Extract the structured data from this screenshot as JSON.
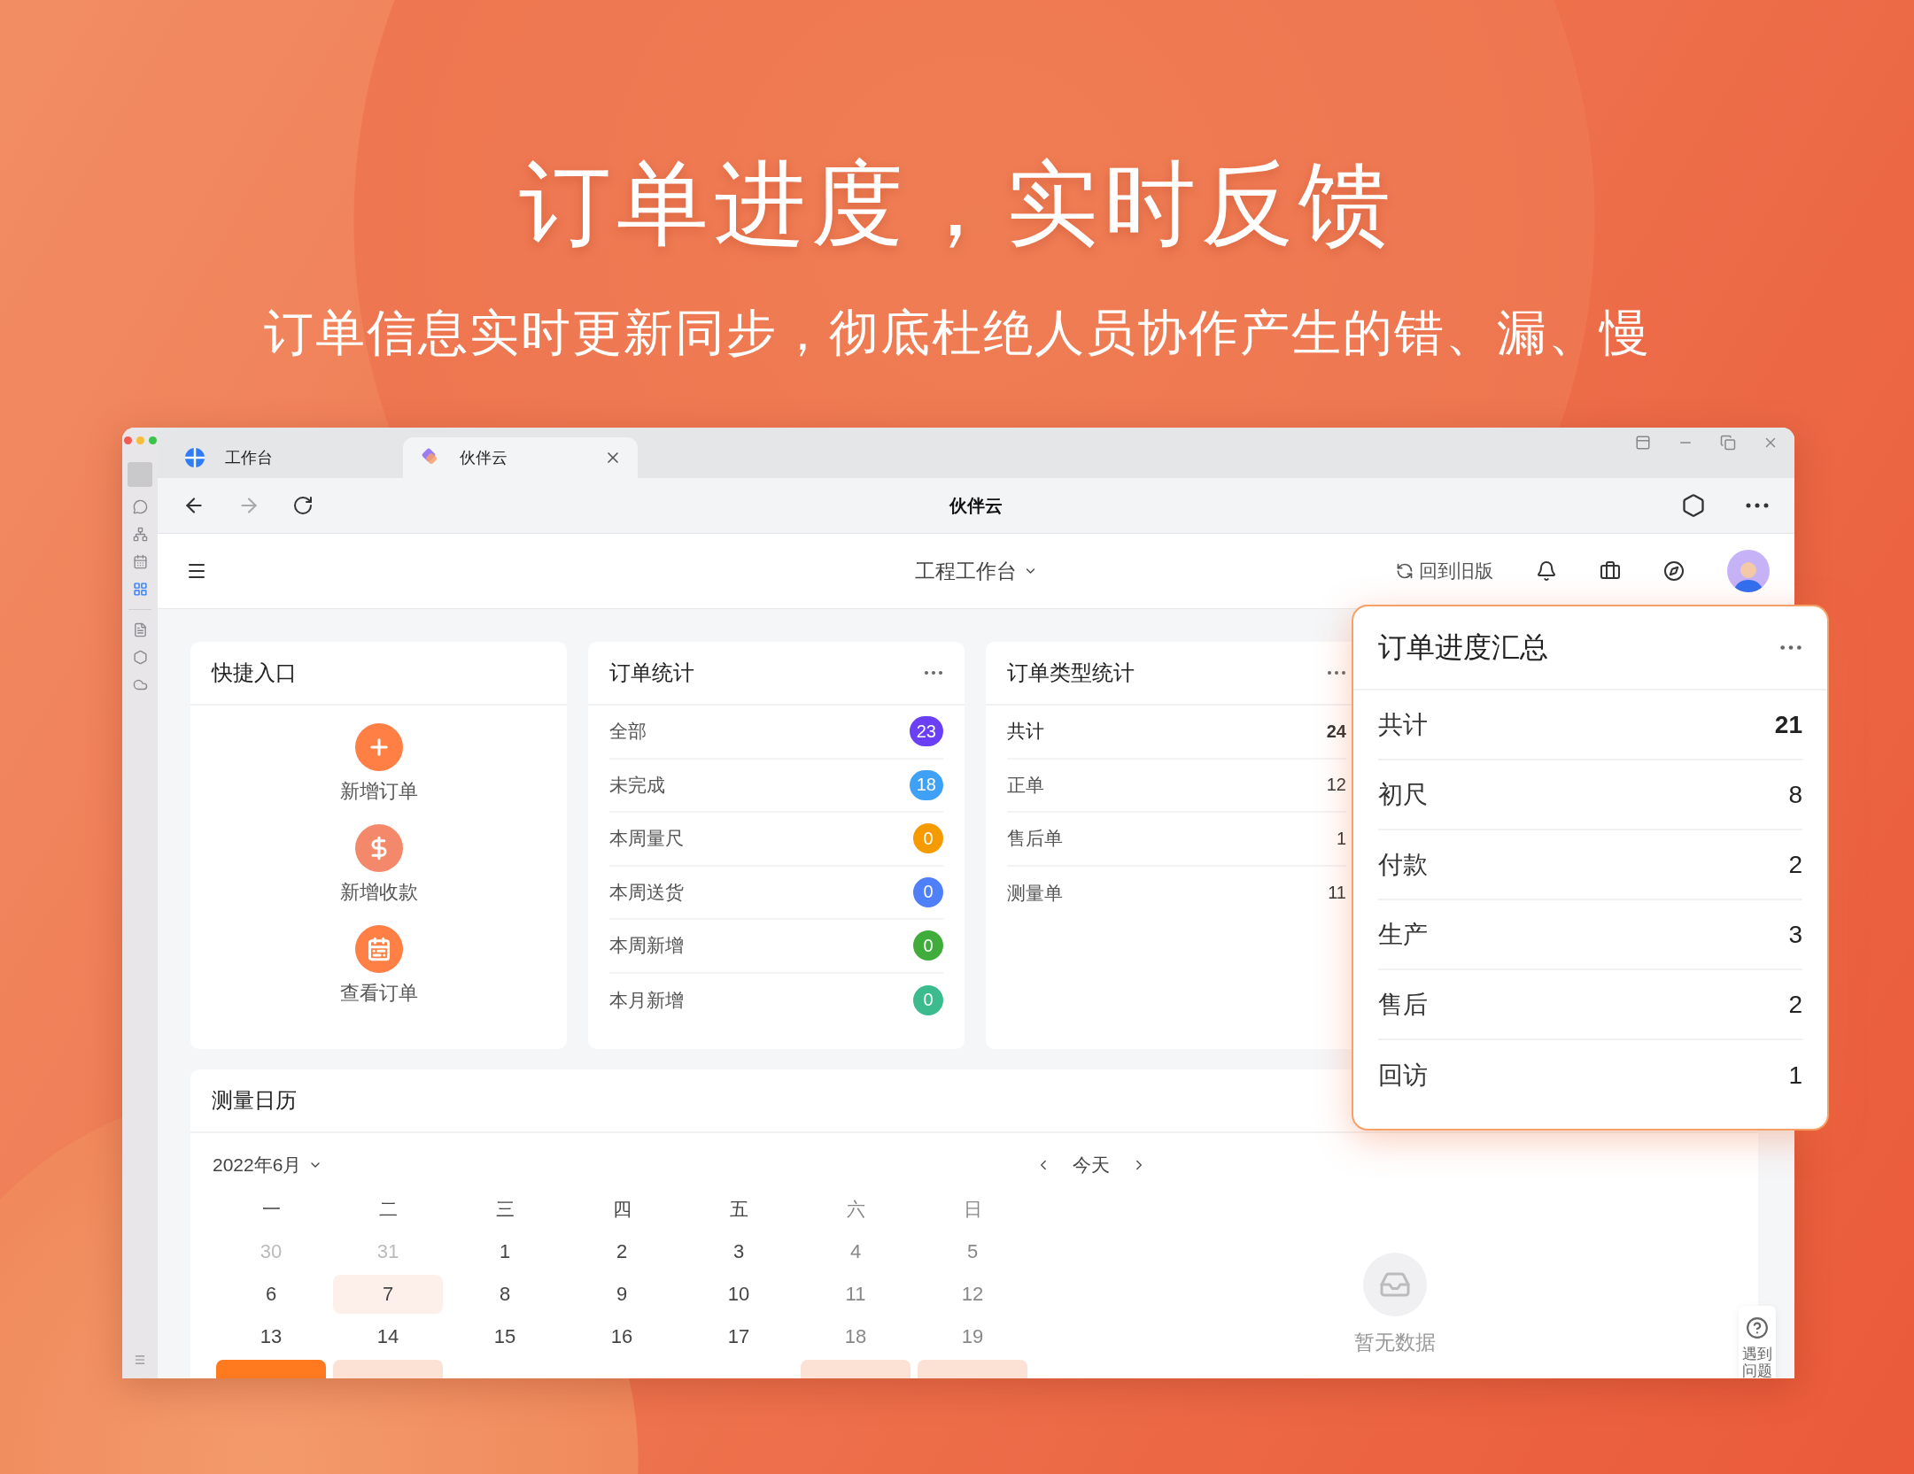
{
  "poster": {
    "headline": "订单进度，实时反馈",
    "subheadline": "订单信息实时更新同步，彻底杜绝人员协作产生的错、漏、慢"
  },
  "sidebar": {
    "items": [
      {
        "selected": false
      },
      {
        "selected": false
      },
      {
        "selected": false
      },
      {
        "selected": true
      },
      {
        "selected": false
      },
      {
        "selected": false
      },
      {
        "selected": false
      }
    ]
  },
  "browser": {
    "tabs": [
      {
        "label": "工作台",
        "selected": false
      },
      {
        "label": "伙伴云",
        "selected": true
      }
    ],
    "page_title": "伙伴云"
  },
  "app_header": {
    "workspace": "工程工作台",
    "old_version_link": "回到旧版"
  },
  "quick_entry": {
    "title": "快捷入口",
    "items": [
      {
        "label": "新增订单",
        "kind": "add"
      },
      {
        "label": "新增收款",
        "kind": "payment"
      },
      {
        "label": "查看订单",
        "kind": "calendar"
      }
    ]
  },
  "order_stats": {
    "title": "订单统计",
    "rows": [
      {
        "label": "全部",
        "count": "23",
        "color": "#6b3ff6"
      },
      {
        "label": "未完成",
        "count": "18",
        "color": "#3ea1f6"
      },
      {
        "label": "本周量尺",
        "count": "0",
        "color": "#f59b00"
      },
      {
        "label": "本周送货",
        "count": "0",
        "color": "#4f80f7"
      },
      {
        "label": "本周新增",
        "count": "0",
        "color": "#3fac3c"
      },
      {
        "label": "本月新增",
        "count": "0",
        "color": "#3cbc8e"
      }
    ]
  },
  "type_stats": {
    "title": "订单类型统计",
    "rows": [
      {
        "label": "共计",
        "value": "24",
        "kind": "total"
      },
      {
        "label": "正单",
        "value": "12",
        "kind": "item"
      },
      {
        "label": "售后单",
        "value": "1",
        "kind": "item"
      },
      {
        "label": "测量单",
        "value": "11",
        "kind": "item"
      }
    ]
  },
  "progress_summary": {
    "title": "订单进度汇总",
    "rows": [
      {
        "label": "共计",
        "value": "21",
        "kind": "total"
      },
      {
        "label": "初尺",
        "value": "8",
        "kind": "item"
      },
      {
        "label": "付款",
        "value": "2",
        "kind": "item"
      },
      {
        "label": "生产",
        "value": "3",
        "kind": "item"
      },
      {
        "label": "售后",
        "value": "2",
        "kind": "item"
      },
      {
        "label": "回访",
        "value": "1",
        "kind": "item"
      }
    ]
  },
  "calendar": {
    "title": "测量日历",
    "month": "2022年6月",
    "today_button": "今天",
    "weekdays": [
      {
        "label": "一",
        "weekend": false
      },
      {
        "label": "二",
        "weekend": false
      },
      {
        "label": "三",
        "weekend": false
      },
      {
        "label": "四",
        "weekend": false
      },
      {
        "label": "五",
        "weekend": false
      },
      {
        "label": "六",
        "weekend": true
      },
      {
        "label": "日",
        "weekend": true
      }
    ],
    "weeks": [
      [
        {
          "day": "30",
          "outside_month": true,
          "weekend": false,
          "marked": false
        },
        {
          "day": "31",
          "outside_month": true,
          "weekend": false,
          "marked": false
        },
        {
          "day": "1",
          "outside_month": false,
          "weekend": false,
          "marked": false
        },
        {
          "day": "2",
          "outside_month": false,
          "weekend": false,
          "marked": false
        },
        {
          "day": "3",
          "outside_month": false,
          "weekend": false,
          "marked": false
        },
        {
          "day": "4",
          "outside_month": false,
          "weekend": true,
          "marked": false
        },
        {
          "day": "5",
          "outside_month": false,
          "weekend": true,
          "marked": false
        }
      ],
      [
        {
          "day": "6",
          "outside_month": false,
          "weekend": false,
          "marked": false
        },
        {
          "day": "7",
          "outside_month": false,
          "weekend": false,
          "marked": true
        },
        {
          "day": "8",
          "outside_month": false,
          "weekend": false,
          "marked": false
        },
        {
          "day": "9",
          "outside_month": false,
          "weekend": false,
          "marked": false
        },
        {
          "day": "10",
          "outside_month": false,
          "weekend": false,
          "marked": false
        },
        {
          "day": "11",
          "outside_month": false,
          "weekend": true,
          "marked": false
        },
        {
          "day": "12",
          "outside_month": false,
          "weekend": true,
          "marked": false
        }
      ],
      [
        {
          "day": "13",
          "outside_month": false,
          "weekend": false,
          "marked": false
        },
        {
          "day": "14",
          "outside_month": false,
          "weekend": false,
          "marked": false
        },
        {
          "day": "15",
          "outside_month": false,
          "weekend": false,
          "marked": false
        },
        {
          "day": "16",
          "outside_month": false,
          "weekend": false,
          "marked": false
        },
        {
          "day": "17",
          "outside_month": false,
          "weekend": false,
          "marked": false
        },
        {
          "day": "18",
          "outside_month": false,
          "weekend": true,
          "marked": false
        },
        {
          "day": "19",
          "outside_month": false,
          "weekend": true,
          "marked": false
        }
      ]
    ],
    "cut_row": {
      "weekday_cells": [
        {
          "selected": true
        },
        {
          "selected": false
        }
      ],
      "weekend_cells": [
        {
          "selected": false
        },
        {
          "selected": false
        }
      ]
    }
  },
  "empty_state": {
    "text": "暂无数据"
  },
  "help": {
    "label": "遇到问题"
  }
}
